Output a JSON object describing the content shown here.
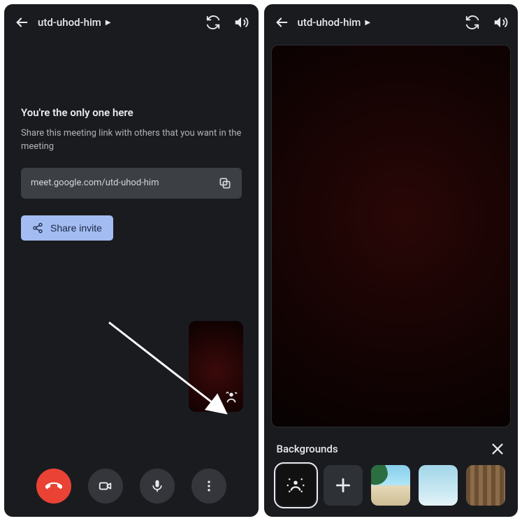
{
  "left": {
    "meeting_id": "utd-uhod-him",
    "only_one_title": "You're the only one here",
    "sub_text": "Share this meeting link with others that you want in the meeting",
    "meeting_link": "meet.google.com/utd-uhod-him",
    "share_label": "Share invite"
  },
  "right": {
    "meeting_id": "utd-uhod-him",
    "panel_title": "Backgrounds",
    "options": [
      {
        "name": "blur",
        "selected": true
      },
      {
        "name": "add"
      },
      {
        "name": "beach"
      },
      {
        "name": "sky"
      },
      {
        "name": "bookshelf"
      }
    ]
  }
}
